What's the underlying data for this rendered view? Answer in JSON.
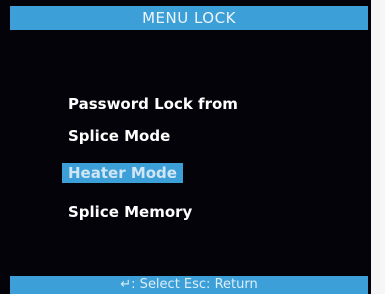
{
  "title": "MENU LOCK",
  "menu": {
    "items": [
      {
        "label": "Password Lock from",
        "selected": false
      },
      {
        "label": "Splice Mode",
        "selected": false
      },
      {
        "label": "Heater Mode",
        "selected": true
      },
      {
        "label": "Splice Memory",
        "selected": false
      }
    ]
  },
  "footer": {
    "hint": "↵: Select   Esc: Return"
  },
  "colors": {
    "background": "#04030a",
    "accent": "#3d9fd8",
    "text": "#ffffff"
  }
}
